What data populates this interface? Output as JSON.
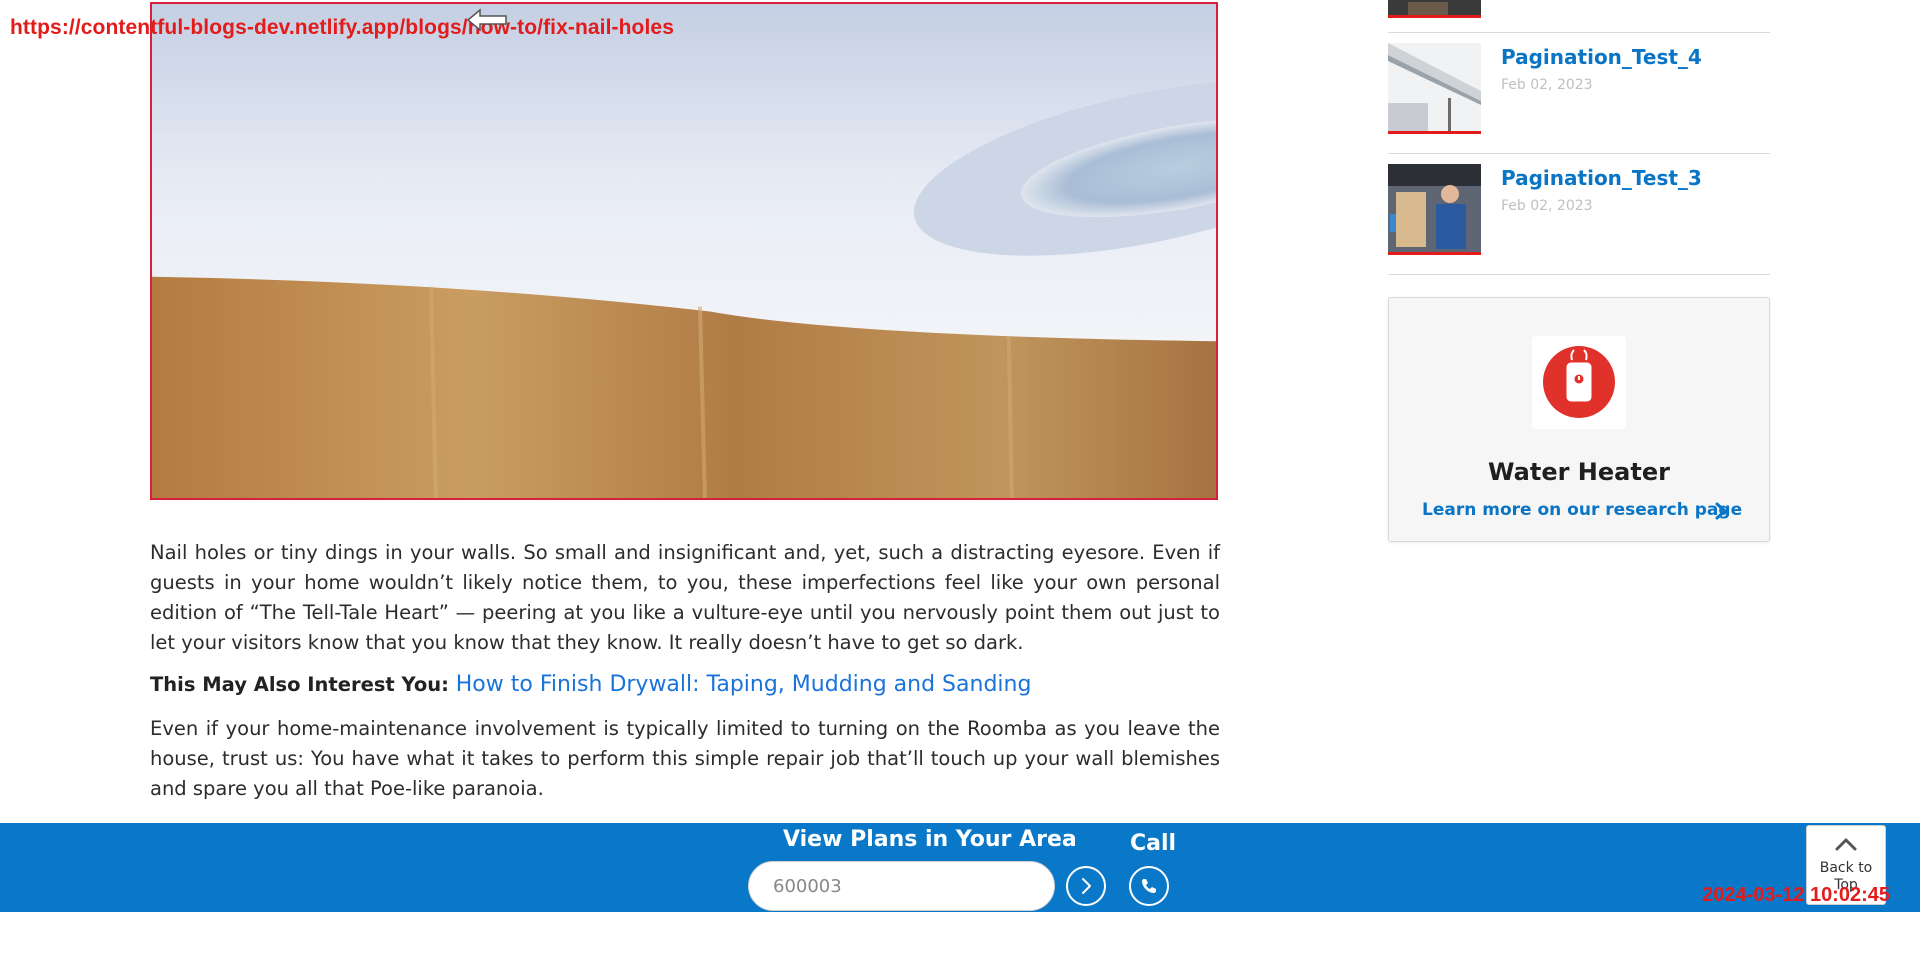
{
  "overlay": {
    "url": "https://contentful-blogs-dev.netlify.app/blogs/how-to/fix-nail-holes",
    "timestamp": "2024-03-12 10:02:45"
  },
  "article": {
    "paragraph1": "Nail holes or tiny dings in your walls. So small and insignificant and, yet, such a distracting eyesore. Even if guests in your home wouldn’t likely notice them, to you, these imperfections feel like your own personal edition of “The Tell-Tale Heart” — peering at you like a vulture-eye until you nervously point them out just to let your visitors know that you know that they know. It really doesn’t have to get so dark.",
    "interest_lead": "This May Also Interest You: ",
    "interest_link": "How to Finish Drywall: Taping, Mudding and Sanding",
    "paragraph2": "Even if your home-maintenance involvement is typically limited to turning on the Roomba as you leave the house, trust us: You have what it takes to perform this simple repair job that’ll touch up your wall blemishes and spare you all that Poe-like paranoia."
  },
  "sidebar": {
    "posts": [
      {
        "title": "Pagination_Test_4",
        "date": "Feb 02, 2023"
      },
      {
        "title": "Pagination_Test_3",
        "date": "Feb 02, 2023"
      }
    ],
    "card": {
      "title": "Water Heater",
      "link": "Learn more on our research page"
    }
  },
  "footer": {
    "plans_title": "View Plans in Your Area",
    "zip_value": "600003",
    "call_label": "Call",
    "back_to_top": "Back to Top"
  },
  "colors": {
    "accent_red": "#e31b1b",
    "footer_blue": "#0a78c8",
    "link_blue": "#0a74c5"
  },
  "icons": [
    "cursor-icon",
    "chevron-right-icon",
    "phone-icon",
    "water-heater-icon",
    "chevron-up-icon"
  ]
}
